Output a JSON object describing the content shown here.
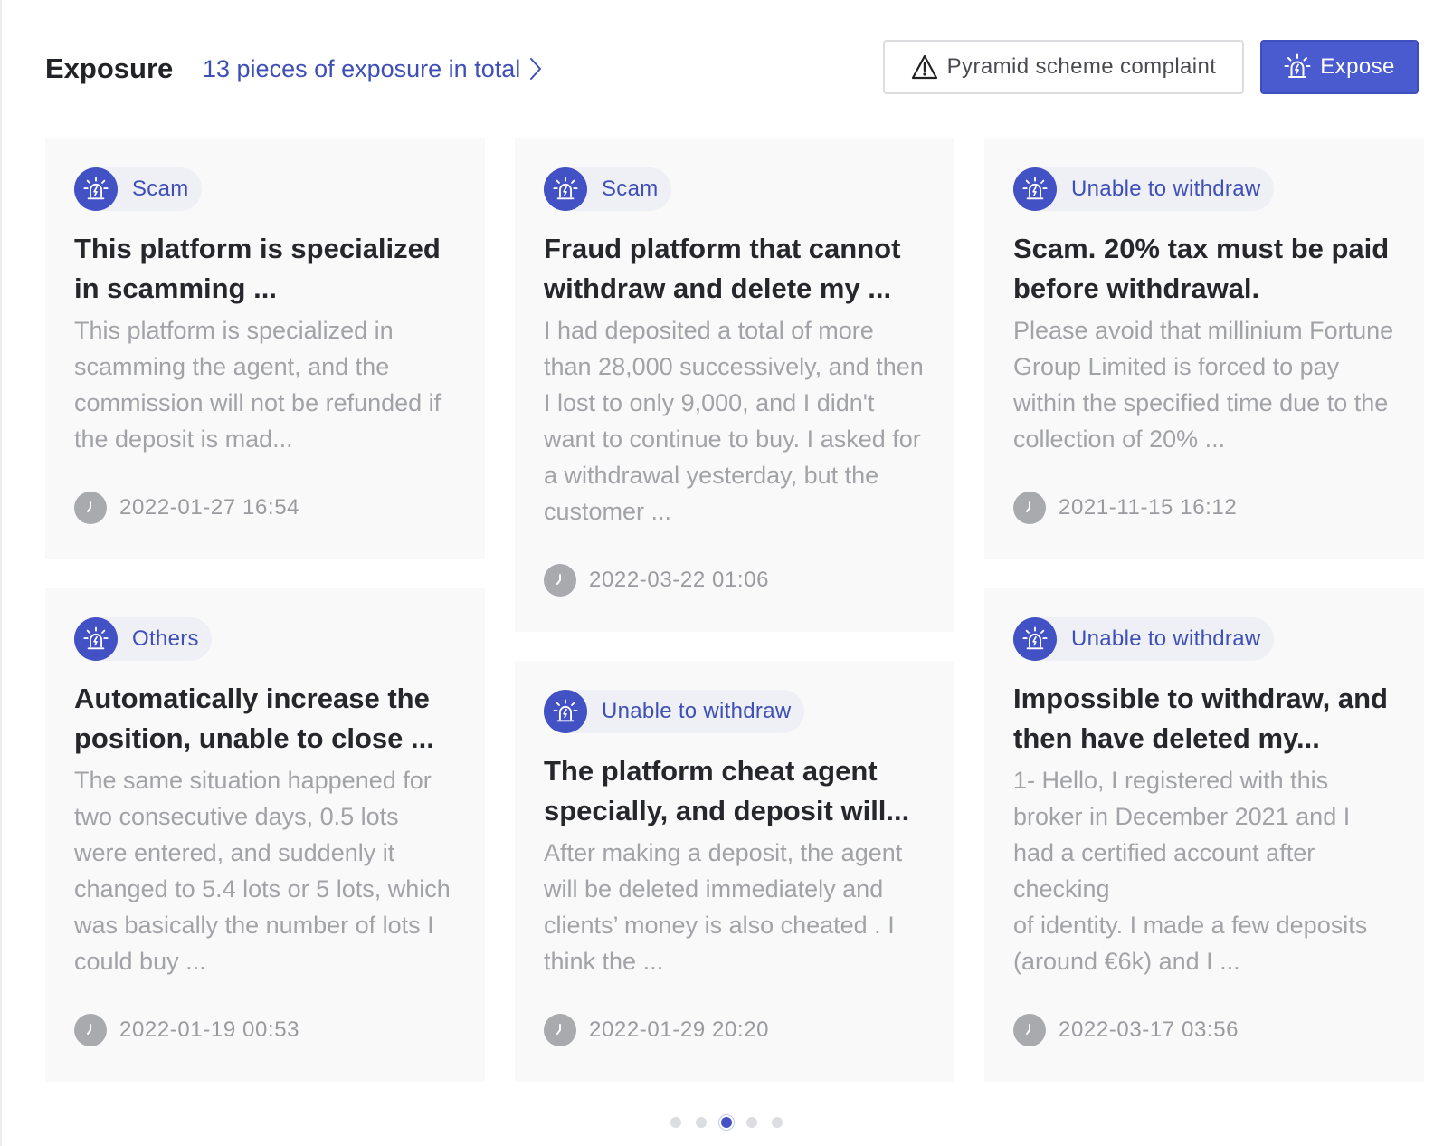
{
  "header": {
    "title": "Exposure",
    "total_link": "13 pieces of exposure in total",
    "complaint_button": "Pyramid scheme complaint",
    "expose_button": "Expose"
  },
  "colors": {
    "accent": "#4a5bd0",
    "link": "#3e4fb8",
    "card_bg": "#f9f9fa",
    "muted_text": "#a2a3a7"
  },
  "cards": [
    {
      "tag": "Scam",
      "title": "This platform is specialized in scamming ...",
      "body": "This platform is specialized in scamming the agent, and the commission will not be refunded if the deposit is mad...",
      "date": "2022-01-27 16:54"
    },
    {
      "tag": "Scam",
      "title": "Fraud platform that cannot withdraw and delete my ...",
      "body": "I had deposited a total of more than 28,000 successively, and then I lost to only 9,000, and I didn't want to continue to buy. I asked for a withdrawal yesterday, but the customer ...",
      "date": "2022-03-22 01:06"
    },
    {
      "tag": "Unable to withdraw",
      "title": "Scam. 20% tax must be paid before withdrawal.",
      "body": "Please avoid that millinium Fortune Group Limited is forced to pay within the specified time due to the collection of 20% ...",
      "date": "2021-11-15 16:12"
    },
    {
      "tag": "Others",
      "title": "Automatically increase the position, unable to close ...",
      "body": "The same situation happened for two consecutive days, 0.5 lots were entered, and suddenly it changed to 5.4 lots or 5 lots, which was basically the number of lots I could buy ...",
      "date": "2022-01-19 00:53"
    },
    {
      "tag": "Unable to withdraw",
      "title": "The platform cheat agent specially, and deposit will...",
      "body": "After making a deposit, the agent will be deleted immediately and clients’ money is also cheated . I think the ...",
      "date": "2022-01-29 20:20"
    },
    {
      "tag": "Unable to withdraw",
      "title": "Impossible to withdraw, and then have deleted my...",
      "body": "1- Hello, I registered with this broker in December 2021 and I had a certified account after checking\nof identity. I made a few deposits (around €6k) and I ...",
      "date": "2022-03-17 03:56"
    }
  ],
  "pagination": {
    "total_pages": 5,
    "current_page": 3
  }
}
